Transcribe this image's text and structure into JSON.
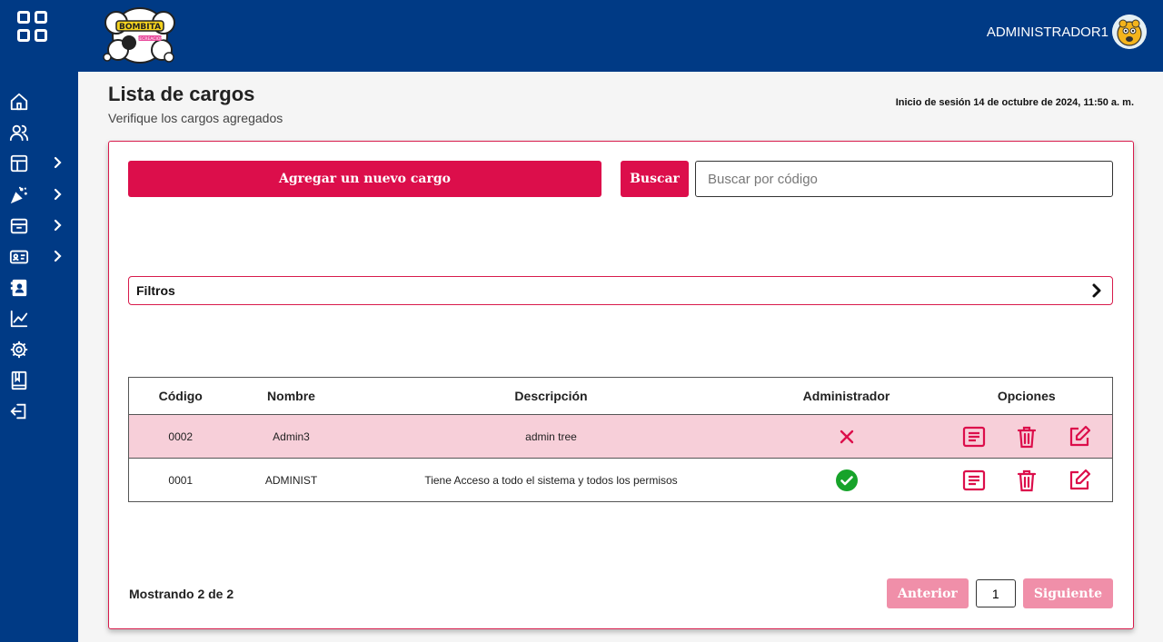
{
  "header": {
    "user_name": "ADMINISTRADOR1",
    "logo_text": "BOMBITA RECREACION"
  },
  "sidebar": {
    "items": [
      {
        "icon": "home-icon"
      },
      {
        "icon": "users-icon"
      },
      {
        "icon": "layout-icon",
        "expandable": true
      },
      {
        "icon": "party-icon",
        "expandable": true
      },
      {
        "icon": "archive-icon",
        "expandable": true
      },
      {
        "icon": "id-card-icon",
        "expandable": true
      },
      {
        "icon": "contacts-icon"
      },
      {
        "icon": "chart-icon"
      },
      {
        "icon": "settings-icon"
      },
      {
        "icon": "book-icon"
      },
      {
        "icon": "logout-icon"
      }
    ]
  },
  "page": {
    "title": "Lista de cargos",
    "subtitle": "Verifique los cargos agregados",
    "session": "Inicio de sesión 14 de octubre de 2024, 11:50 a. m."
  },
  "toolbar": {
    "add_label": "Agregar un nuevo cargo",
    "search_label": "Buscar",
    "search_placeholder": "Buscar por código",
    "search_value": ""
  },
  "filters": {
    "label": "Filtros"
  },
  "table": {
    "headers": [
      "Código",
      "Nombre",
      "Descripción",
      "Administrador",
      "Opciones"
    ],
    "rows": [
      {
        "code": "0002",
        "name": "Admin3",
        "description": "admin tree",
        "admin": false
      },
      {
        "code": "0001",
        "name": "ADMINIST",
        "description": "Tiene Acceso a todo el sistema y todos los permisos",
        "admin": true
      }
    ]
  },
  "footer": {
    "showing": "Mostrando 2 de 2",
    "prev_label": "Anterior",
    "page": "1",
    "next_label": "Siguiente"
  },
  "colors": {
    "primary": "#003a85",
    "accent": "#dc0e4b",
    "accent_disabled": "#f08fa9",
    "row_highlight": "#f7cfd9",
    "success": "#17a32a"
  }
}
